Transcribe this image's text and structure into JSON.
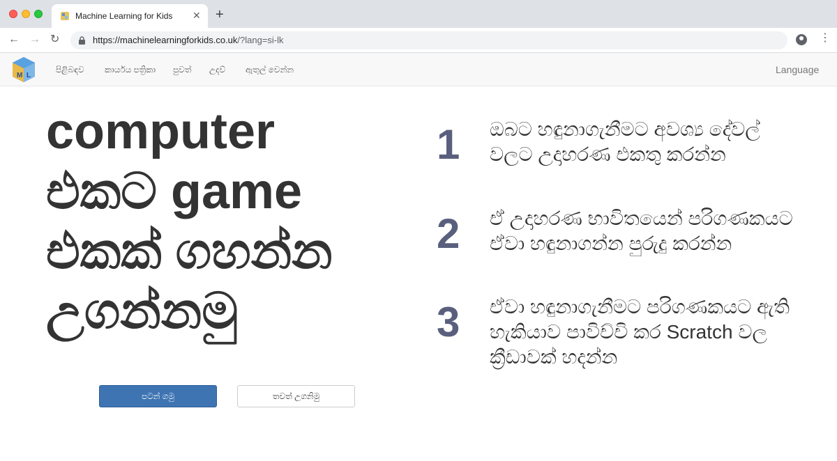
{
  "browser": {
    "tab_title": "Machine Learning for Kids",
    "tab_close": "✕",
    "new_tab": "+",
    "url_host": "https://machinelearningforkids.co.uk",
    "url_path": "/?lang=si-lk"
  },
  "nav": {
    "items": [
      {
        "label": "පිළිබඳව"
      },
      {
        "label": "කාර්යය පත්‍රිකා"
      },
      {
        "label": "පුවත්"
      },
      {
        "label": "උදව්"
      },
      {
        "label": "ඇතුල් වෙන්න"
      }
    ],
    "language": "Language"
  },
  "hero": {
    "line1": "computer",
    "line2": "එකට game",
    "line3": "එකක් ගහන්න",
    "line4": "උගන්නමු"
  },
  "buttons": {
    "start": "පටන් ගමු",
    "learn_more": "තවත් උගනිමු"
  },
  "steps": [
    {
      "number": "1",
      "text": "ඔබට හඳුනාගැනීමට අවශ්‍ය දේවල් වලට උදාහරණ එකතු කරන්න"
    },
    {
      "number": "2",
      "text": "ඒ උදාහරණ භාවිතයෙන් පරිගණකයට ඒවා හඳුනාගන්න පුරුදු කරන්න"
    },
    {
      "number": "3",
      "text": "ඒවා හඳුනාගැනීමට පරිගණකයට ඇති හැකියාව පාවිච්චි කර Scratch වල ක්‍රීඩාවක් හදන්න"
    }
  ],
  "colors": {
    "primary_button": "#3f74b3",
    "step_number": "#5a5f7d"
  }
}
